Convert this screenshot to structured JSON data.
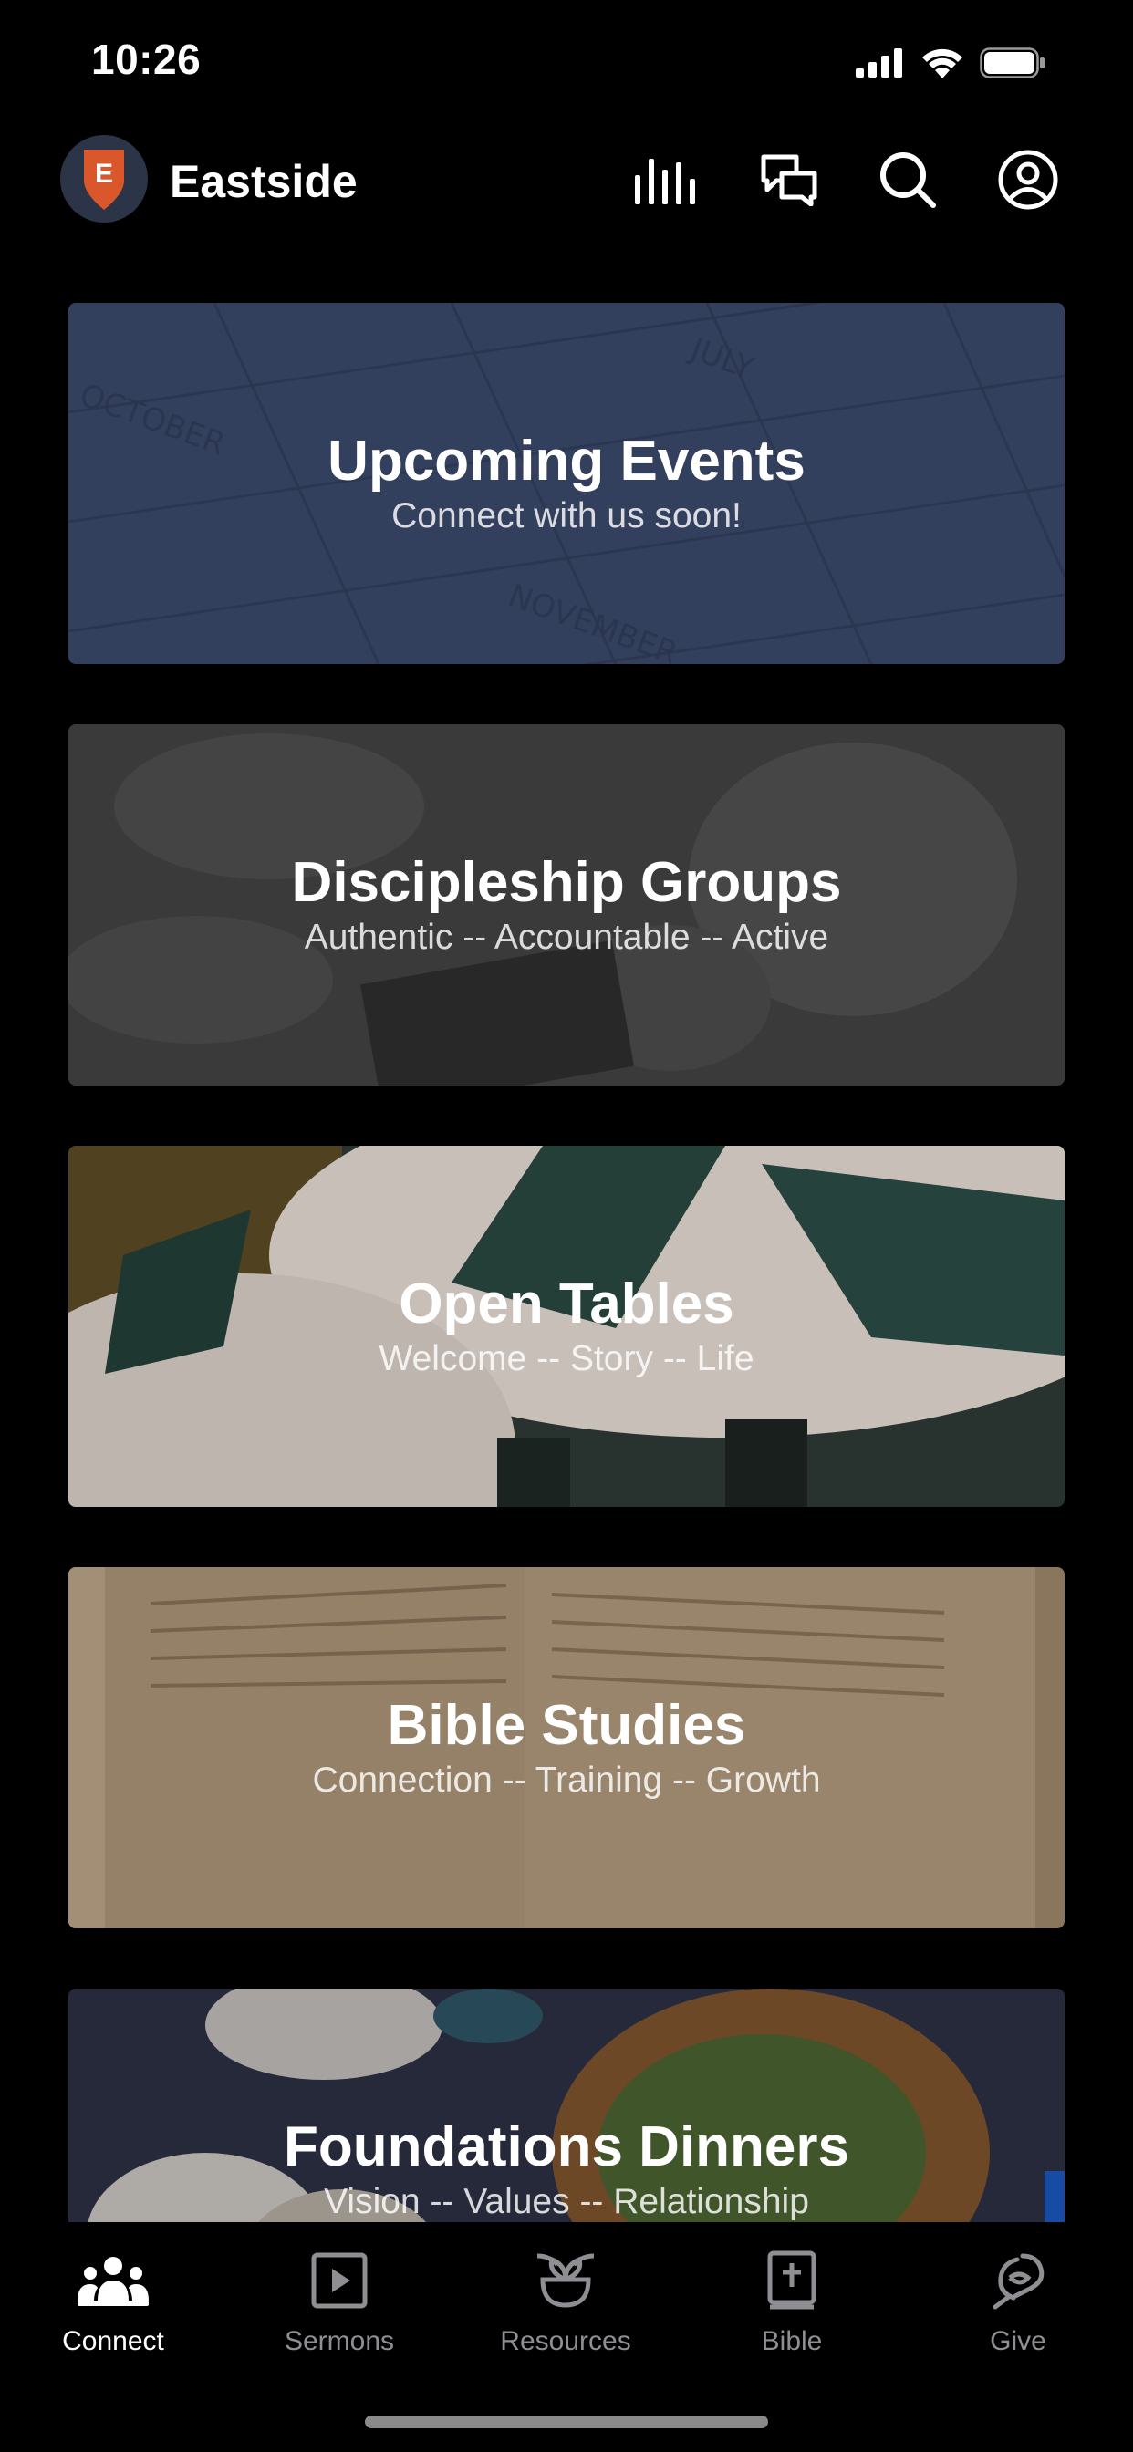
{
  "status_bar": {
    "time": "10:26",
    "icons": [
      "signal-icon",
      "wifi-icon",
      "battery-icon"
    ]
  },
  "header": {
    "logo_letter": "E",
    "brand_name": "Eastside",
    "actions": [
      "audio-bars-icon",
      "chat-icon",
      "search-icon",
      "account-icon"
    ]
  },
  "cards": [
    {
      "title": "Upcoming Events",
      "subtitle": "Connect with us soon!"
    },
    {
      "title": "Discipleship Groups",
      "subtitle": "Authentic -- Accountable -- Active"
    },
    {
      "title": "Open Tables",
      "subtitle": "Welcome -- Story -- Life"
    },
    {
      "title": "Bible Studies",
      "subtitle": "Connection -- Training -- Growth"
    },
    {
      "title": "Foundations Dinners",
      "subtitle": "Vision -- Values -- Relationship"
    }
  ],
  "tabs": [
    {
      "label": "Connect",
      "icon": "people-icon",
      "active": true
    },
    {
      "label": "Sermons",
      "icon": "play-icon",
      "active": false
    },
    {
      "label": "Resources",
      "icon": "plant-icon",
      "active": false
    },
    {
      "label": "Bible",
      "icon": "bible-icon",
      "active": false
    },
    {
      "label": "Give",
      "icon": "give-icon",
      "active": false
    }
  ],
  "colors": {
    "background": "#000000",
    "logo_bg": "#2c3447",
    "logo_mark": "#d9572b",
    "tab_inactive": "#8e8e93",
    "tab_active": "#ffffff"
  }
}
